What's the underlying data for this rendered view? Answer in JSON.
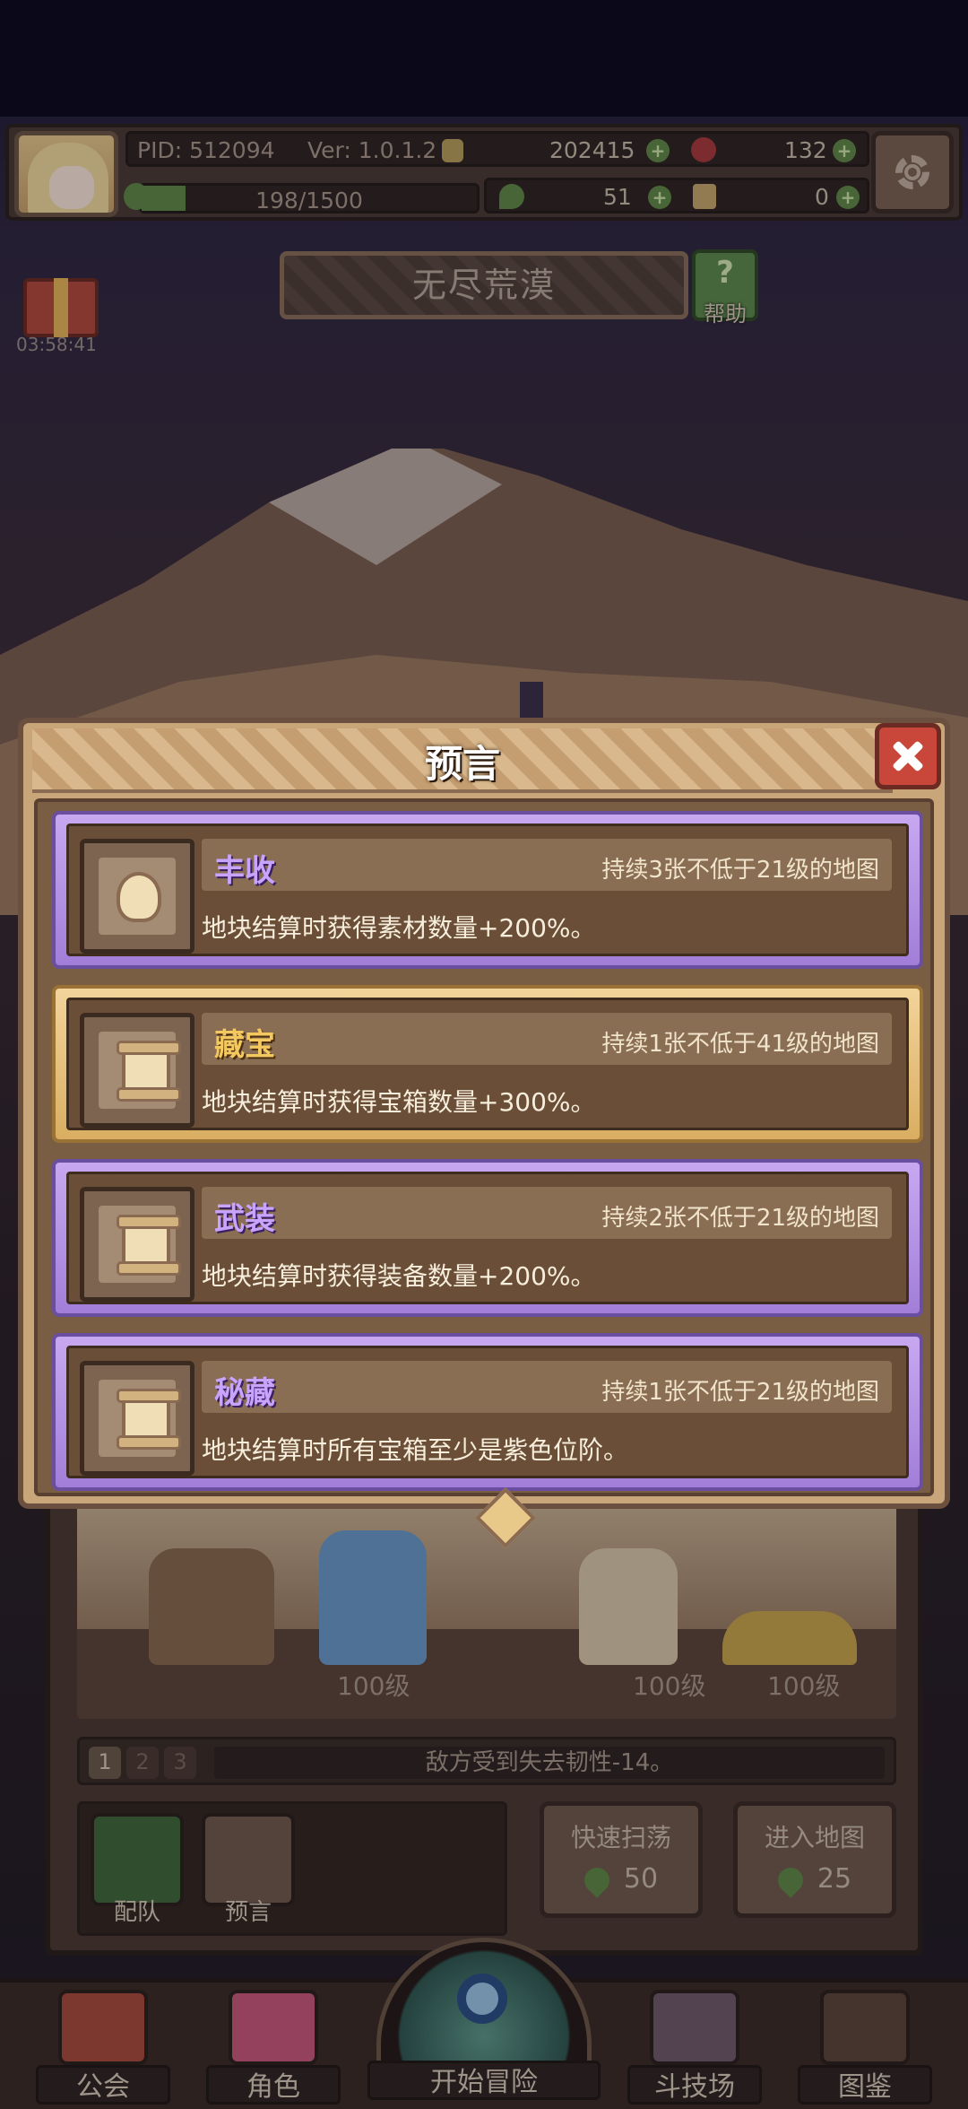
{
  "player": {
    "pid": "PID: 512094",
    "version": "Ver: 1.0.1.2",
    "gold": "202415",
    "gems": "132",
    "clover": "51",
    "keys": "0",
    "exp": "198/1500",
    "exp_progress": 0.132
  },
  "gift": {
    "timer": "03:58:41"
  },
  "map": {
    "title": "无尽荒漠",
    "help_label": "帮助"
  },
  "battle": {
    "levels": [
      "100级",
      "100级",
      "100级"
    ],
    "skill_tabs": [
      "1",
      "2",
      "3"
    ],
    "skill_text": "敌方受到失去韧性-14。",
    "team_label": "配队",
    "prophecy_label": "预言",
    "sweep_label": "快速扫荡",
    "sweep_cost": "50",
    "enter_label": "进入地图",
    "enter_cost": "25"
  },
  "nav": {
    "guild": "公会",
    "character": "角色",
    "adventure": "开始冒险",
    "arena": "斗技场",
    "codex": "图鉴"
  },
  "modal": {
    "title": "预言",
    "cards": [
      {
        "name": "丰收",
        "duration": "持续3张不低于21级的地图",
        "desc": "地块结算时获得素材数量+200%。",
        "rarity": "purple",
        "icon": "wheat-icon"
      },
      {
        "name": "藏宝",
        "duration": "持续1张不低于41级的地图",
        "desc": "地块结算时获得宝箱数量+300%。",
        "rarity": "gold",
        "icon": "scroll-icon"
      },
      {
        "name": "武装",
        "duration": "持续2张不低于21级的地图",
        "desc": "地块结算时获得装备数量+200%。",
        "rarity": "purple",
        "icon": "scroll-icon"
      },
      {
        "name": "秘藏",
        "duration": "持续1张不低于21级的地图",
        "desc": "地块结算时所有宝箱至少是紫色位阶。",
        "rarity": "purple",
        "icon": "scroll-icon"
      }
    ]
  },
  "colors": {
    "purple_frame": "#a27ed8",
    "gold_frame": "#d9ae62",
    "close_red": "#c8463a",
    "green_accent": "#5f8a46"
  }
}
